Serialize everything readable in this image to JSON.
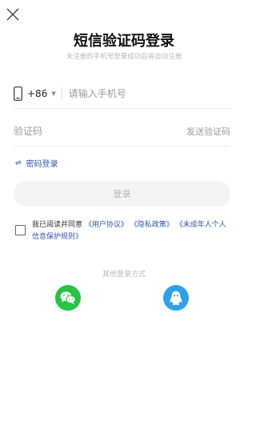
{
  "header": {
    "close_icon": "close-icon",
    "title": "短信验证码登录",
    "subtitle": "未注册的手机号登录成功后将自动注册"
  },
  "phone": {
    "icon": "phone-icon",
    "country_code": "+86",
    "caret": "▼",
    "placeholder": "请输入手机号"
  },
  "code": {
    "placeholder": "验证码",
    "send_label": "发送验证码"
  },
  "password_login": {
    "icon": "swap-icon",
    "label": "密码登录"
  },
  "login_button": {
    "label": "登录"
  },
  "agreement": {
    "prefix": "我已阅读并同意",
    "user_agreement": "《用户协议》",
    "privacy_policy": "《隐私政策》",
    "minor_policy": "《未成年人个人信息保护规则》",
    "checked": false
  },
  "other_login": {
    "title": "其他登录方式",
    "providers": [
      {
        "name_icon": "wechat-icon",
        "color": "#25c444"
      },
      {
        "name_icon": "qq-icon",
        "color": "#2ea0ee"
      }
    ]
  },
  "colors": {
    "link": "#2f57a8",
    "muted": "#b8b8b8",
    "button_bg": "#f4f4f4"
  }
}
